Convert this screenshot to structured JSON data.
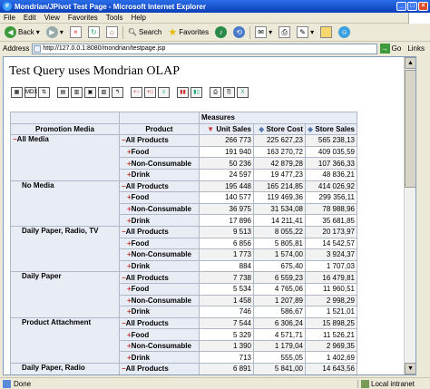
{
  "window": {
    "title": "Mondrian/JPivot Test Page - Microsoft Internet Explorer"
  },
  "menu": [
    "File",
    "Edit",
    "View",
    "Favorites",
    "Tools",
    "Help"
  ],
  "toolbar": {
    "back": "Back",
    "search": "Search",
    "favorites": "Favorites"
  },
  "address": {
    "label": "Address",
    "url": "http://127.0.0.1:8080/mondrian/testpage.jsp",
    "go": "Go",
    "links": "Links"
  },
  "page": {
    "title": "Test Query uses Mondrian OLAP"
  },
  "jpivot_buttons": [
    "cube-nav-icon",
    "mdx-icon",
    "order-icon",
    "drill-member-icon",
    "drill-position-icon",
    "drill-replace-icon",
    "drill-through-icon",
    "swap-axes-icon",
    "hide-empty-rows-icon",
    "hide-empty-cols-icon",
    "chart-icon",
    "chart-config-icon",
    "print-config-icon",
    "pdf-icon",
    "excel-icon"
  ],
  "table": {
    "measures_label": "Measures",
    "row_headers": [
      "Promotion Media",
      "Product"
    ],
    "measure_headers": [
      "Unit Sales",
      "Store Cost",
      "Store Sales"
    ],
    "groups": [
      {
        "media": "All Media",
        "media_expanded": true,
        "rows": [
          {
            "product": "All Products",
            "expanded": true,
            "values": [
              "266 773",
              "225 627,23",
              "565 238,13"
            ]
          },
          {
            "product": "Food",
            "expanded": false,
            "values": [
              "191 940",
              "163 270,72",
              "409 035,59"
            ]
          },
          {
            "product": "Non-Consumable",
            "expanded": false,
            "values": [
              "50 236",
              "42 879,28",
              "107 366,33"
            ]
          },
          {
            "product": "Drink",
            "expanded": false,
            "values": [
              "24 597",
              "19 477,23",
              "48 836,21"
            ]
          }
        ]
      },
      {
        "media": "No Media",
        "media_expanded": false,
        "rows": [
          {
            "product": "All Products",
            "expanded": true,
            "values": [
              "195 448",
              "165 214,85",
              "414 026,92"
            ]
          },
          {
            "product": "Food",
            "expanded": false,
            "values": [
              "140 577",
              "119 469,36",
              "299 356,11"
            ]
          },
          {
            "product": "Non-Consumable",
            "expanded": false,
            "values": [
              "36 975",
              "31 534,08",
              "78 988,96"
            ]
          },
          {
            "product": "Drink",
            "expanded": false,
            "values": [
              "17 896",
              "14 211,41",
              "35 681,85"
            ]
          }
        ]
      },
      {
        "media": "Daily Paper, Radio, TV",
        "media_expanded": false,
        "rows": [
          {
            "product": "All Products",
            "expanded": true,
            "values": [
              "9 513",
              "8 055,22",
              "20 173,97"
            ]
          },
          {
            "product": "Food",
            "expanded": false,
            "values": [
              "6 856",
              "5 805,81",
              "14 542,57"
            ]
          },
          {
            "product": "Non-Consumable",
            "expanded": false,
            "values": [
              "1 773",
              "1 574,00",
              "3 924,37"
            ]
          },
          {
            "product": "Drink",
            "expanded": false,
            "values": [
              "884",
              "675,40",
              "1 707,03"
            ]
          }
        ]
      },
      {
        "media": "Daily Paper",
        "media_expanded": false,
        "rows": [
          {
            "product": "All Products",
            "expanded": true,
            "values": [
              "7 738",
              "6 559,23",
              "16 479,81"
            ]
          },
          {
            "product": "Food",
            "expanded": false,
            "values": [
              "5 534",
              "4 765,06",
              "11 960,51"
            ]
          },
          {
            "product": "Non-Consumable",
            "expanded": false,
            "values": [
              "1 458",
              "1 207,89",
              "2 998,29"
            ]
          },
          {
            "product": "Drink",
            "expanded": false,
            "values": [
              "746",
              "586,67",
              "1 521,01"
            ]
          }
        ]
      },
      {
        "media": "Product Attachment",
        "media_expanded": false,
        "rows": [
          {
            "product": "All Products",
            "expanded": true,
            "values": [
              "7 544",
              "6 306,24",
              "15 898,25"
            ]
          },
          {
            "product": "Food",
            "expanded": false,
            "values": [
              "5 329",
              "4 571,71",
              "11 526,21"
            ]
          },
          {
            "product": "Non-Consumable",
            "expanded": false,
            "values": [
              "1 390",
              "1 179,04",
              "2 969,35"
            ]
          },
          {
            "product": "Drink",
            "expanded": false,
            "values": [
              "713",
              "555,05",
              "1 402,69"
            ]
          }
        ]
      },
      {
        "media": "Daily Paper, Radio",
        "media_expanded": false,
        "rows": [
          {
            "product": "All Products",
            "expanded": true,
            "values": [
              "6 891",
              "5 841,00",
              "14 643,56"
            ]
          }
        ]
      }
    ]
  },
  "status": {
    "text": "Done",
    "zone": "Local intranet"
  }
}
